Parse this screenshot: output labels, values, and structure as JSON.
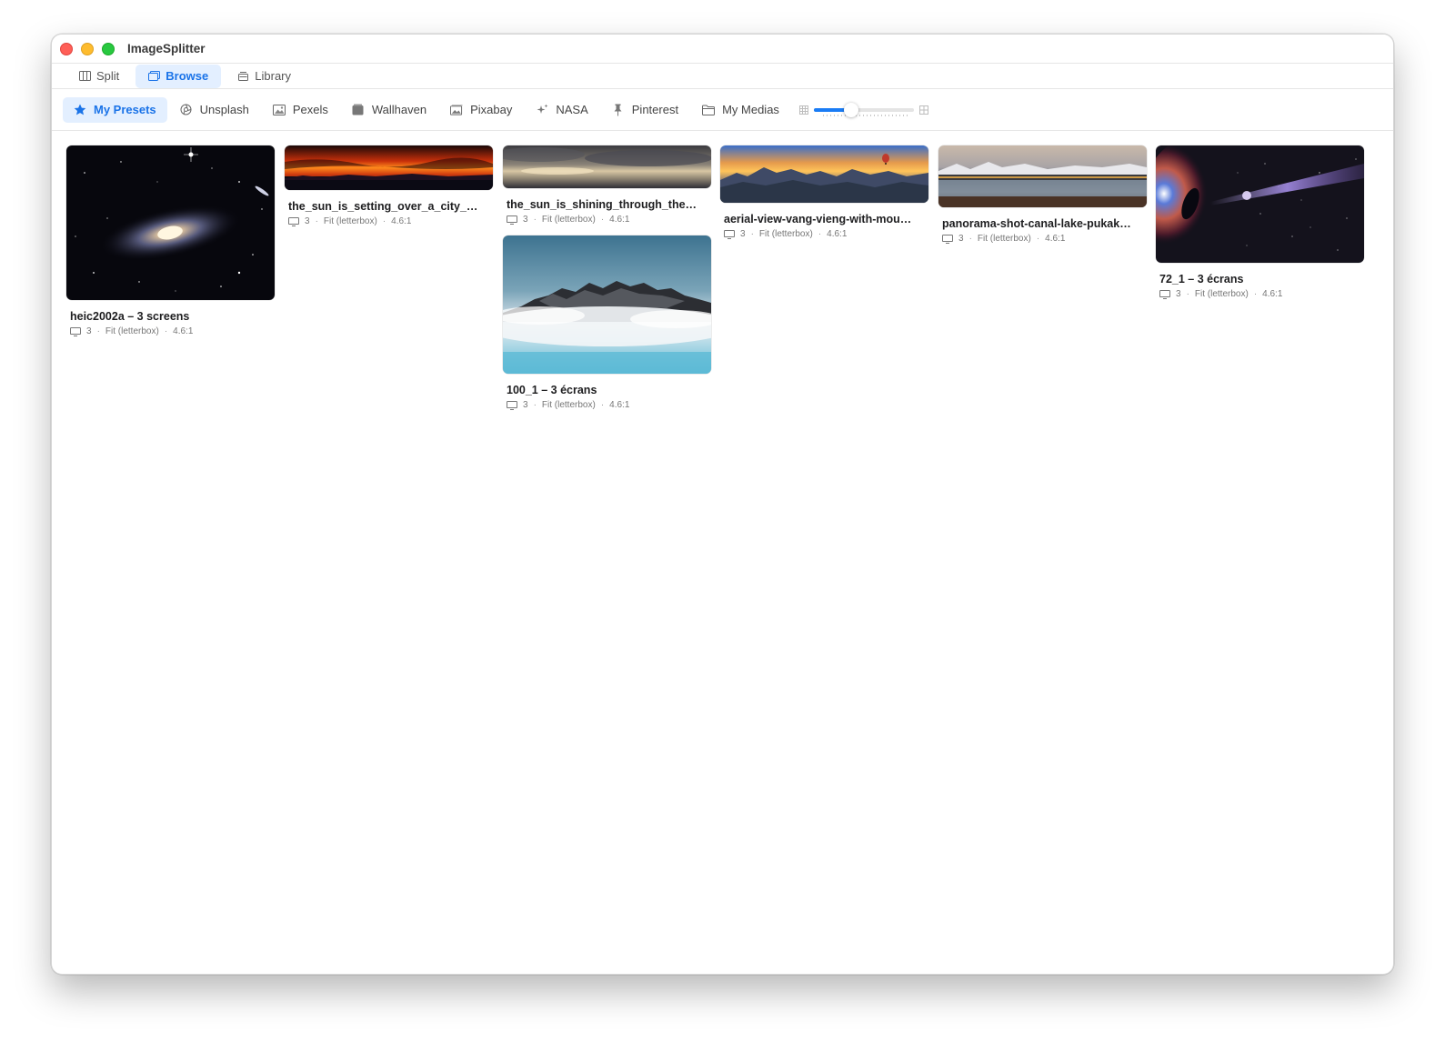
{
  "app": {
    "title": "ImageSplitter"
  },
  "tabs": [
    {
      "label": "Split",
      "icon": "split-icon",
      "active": false
    },
    {
      "label": "Browse",
      "icon": "browse-icon",
      "active": true
    },
    {
      "label": "Library",
      "icon": "library-icon",
      "active": false
    }
  ],
  "sources": [
    {
      "label": "My Presets",
      "icon": "star-icon",
      "active": true
    },
    {
      "label": "Unsplash",
      "icon": "aperture-icon",
      "active": false
    },
    {
      "label": "Pexels",
      "icon": "photo-icon",
      "active": false
    },
    {
      "label": "Wallhaven",
      "icon": "archive-icon",
      "active": false
    },
    {
      "label": "Pixabay",
      "icon": "photos-icon",
      "active": false
    },
    {
      "label": "NASA",
      "icon": "sparkle-icon",
      "active": false
    },
    {
      "label": "Pinterest",
      "icon": "pin-icon",
      "active": false
    },
    {
      "label": "My Medias",
      "icon": "folder-icon",
      "active": false
    }
  ],
  "zoom": {
    "level": 0.35
  },
  "presets": [
    {
      "title": "heic2002a – 3 screens",
      "screens": "3",
      "mode": "Fit (letterbox)",
      "ratio": "4.6:1",
      "image": "galaxy-image"
    },
    {
      "title": "the_sun_is_setting_over_a_city_…",
      "screens": "3",
      "mode": "Fit (letterbox)",
      "ratio": "4.6:1",
      "image": "sunset-city-image"
    },
    {
      "title": "the_sun_is_shining_through_the…",
      "screens": "3",
      "mode": "Fit (letterbox)",
      "ratio": "4.6:1",
      "image": "clouds-image"
    },
    {
      "title": "100_1 – 3 écrans",
      "screens": "3",
      "mode": "Fit (letterbox)",
      "ratio": "4.6:1",
      "image": "rocks-mist-image"
    },
    {
      "title": "aerial-view-vang-vieng-with-mou…",
      "screens": "3",
      "mode": "Fit (letterbox)",
      "ratio": "4.6:1",
      "image": "mountain-sunrise-image"
    },
    {
      "title": "panorama-shot-canal-lake-pukak…",
      "screens": "3",
      "mode": "Fit (letterbox)",
      "ratio": "4.6:1",
      "image": "lake-panorama-image"
    },
    {
      "title": "72_1 – 3 écrans",
      "screens": "3",
      "mode": "Fit (letterbox)",
      "ratio": "4.6:1",
      "image": "black-hole-image"
    }
  ],
  "colors": {
    "accent": "#1a73e8",
    "accent_bg": "#e3efff"
  }
}
